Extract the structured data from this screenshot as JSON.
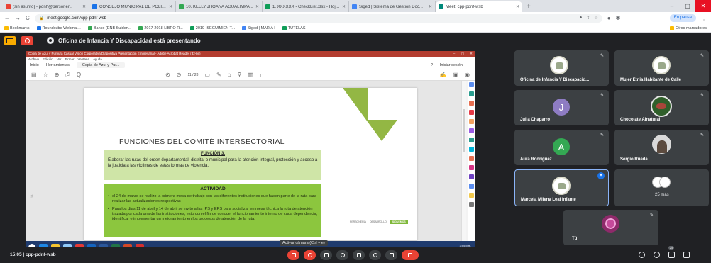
{
  "browser": {
    "tabs": [
      {
        "label": "(sin asunto) - pdnh@personer...",
        "color": "#ea4335",
        "active": false
      },
      {
        "label": "CONSEJO MUNICIPAL DE POLÍTI...",
        "color": "#1a73e8",
        "active": false
      },
      {
        "label": "10. KELLY JHOANA AGUALIMPA...",
        "color": "#34a853",
        "active": false
      },
      {
        "label": "1. XXXXXX - CheckList.xlsx - Hoja...",
        "color": "#0f9d58",
        "active": false
      },
      {
        "label": "Siged | Sistema de Gestión Doc...",
        "color": "#4285f4",
        "active": false
      },
      {
        "label": "Meet: cpp-pdnf-wsb",
        "color": "#00897b",
        "active": true
      }
    ],
    "new_tab": "+",
    "url": "meet.google.com/cpp-pdnf-wsb",
    "pause_label": "En pausa",
    "bookmarks": [
      {
        "label": "Bookmarks",
        "color": "#fbbc04"
      },
      {
        "label": "Roundcube Webmai...",
        "color": "#1a73e8"
      },
      {
        "label": "Banco (ENB Suiden...",
        "color": "#34a853"
      },
      {
        "label": "2017-2018 LIBRO R...",
        "color": "#34a853"
      },
      {
        "label": "2019- SEGUIMIEN T...",
        "color": "#0f9d58"
      },
      {
        "label": "Siged | MARIA I",
        "color": "#4285f4"
      },
      {
        "label": "TUTELAS",
        "color": "#0f9d58"
      }
    ],
    "other_bookmarks": "Otros marcadores"
  },
  "meet": {
    "presenting_text": "Oficina de Infancia Y Discapacidad está presentando",
    "meeting_code": "15:05 | cpp-pdnf-wsb",
    "camera_hint": "Activar cámara (Ctrl + e)",
    "more_count": "25 más",
    "badge_count": "25",
    "participants": [
      {
        "name": "Oficina de Infancia Y Discapacid...",
        "avatar": "logo"
      },
      {
        "name": "Mujer Etnia Habitante de Calle",
        "avatar": "logo"
      },
      {
        "name": "Julia Chaparro",
        "avatar": "J"
      },
      {
        "name": "Chocolate Alnatural",
        "avatar": "choc"
      },
      {
        "name": "Aura Rodríguez",
        "avatar": "A"
      },
      {
        "name": "Sergio Rueda",
        "avatar": "photo"
      },
      {
        "name": "Marcela Milena Leal Infante",
        "avatar": "logo"
      },
      {
        "name": "Tú",
        "avatar": "self"
      }
    ]
  },
  "acrobat": {
    "window_title": "Copia de Azul y Purpura Casual Visión Corporativa Diapositiva Presentación Empresarial - Adobe Acrobat Reader (32-bit)",
    "menu": [
      "Archivo",
      "Edición",
      "Ver",
      "Firmar",
      "Ventana",
      "Ayuda"
    ],
    "tab_home": "Inicio",
    "tab_tools": "Herramientas",
    "tab_doc": "Copia de Azul y Pur...",
    "login": "Iniciar sesión",
    "page_indicator": "11 / 28"
  },
  "slide": {
    "title": "FUNCIONES DEL COMITÉ INTERSECTORIAL",
    "function_heading": "FUNCIÓN 3.",
    "function_text": "Elaborar las rutas del orden  departamental, distrital o municipal para la atención integral, protección y acceso a la justicia a las víctimas de estas formas de violencia.",
    "activity_heading": "ACTIVIDAD",
    "bullet1": "el 24 de marzo se realizo la primera mesa de trabajo con las diferentes instituciones que hacen parte de la ruta para realizar las actualizaciones respectivas",
    "bullet2": "Para los días 11 de abril y 14 de abril se invito a las IPS y EPS para  socializar en mesa técnica la ruta de atención trazada por cada una de las instituciones, esto con el fin de conocer el funcionamiento interno de cada dependencia, identificar e implementar un mejoramiento en los procesos de atención de la ruta.",
    "logo_left": "PERSONERÍA",
    "logo_mid": "DESARROLLO",
    "logo_right": "SIGUEMOS"
  },
  "taskbar": {
    "time": "3:05 p.m.",
    "date": "26/07/2023"
  }
}
